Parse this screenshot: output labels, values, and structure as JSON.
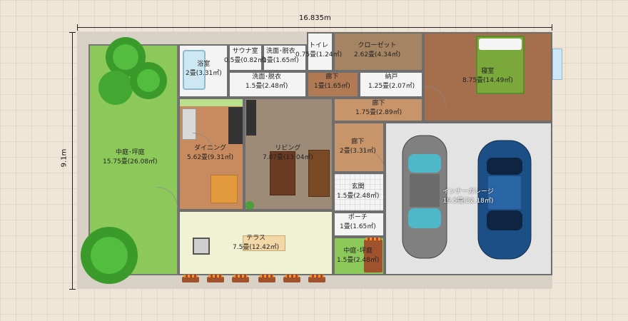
{
  "dimensions": {
    "width_label": "16.835m",
    "height_label": "9.1m"
  },
  "rooms": {
    "garden_left": {
      "name": "中庭･坪庭",
      "area": "15.75畳(26.08㎡)"
    },
    "bath": {
      "name": "浴室",
      "area": "2畳(3.31㎡)"
    },
    "sauna": {
      "name": "サウナ室",
      "area": "0.5畳(0.82㎡)"
    },
    "wash_top": {
      "name": "洗面･脱衣",
      "area": "1畳(1.65㎡)"
    },
    "toilet": {
      "name": "トイレ",
      "area": "0.75畳(1.24㎡)"
    },
    "closet": {
      "name": "クローゼット",
      "area": "2.62畳(4.34㎡)"
    },
    "bedroom": {
      "name": "寝室",
      "area": "8.75畳(14.49㎡)"
    },
    "wash": {
      "name": "洗面･脱衣",
      "area": "1.5畳(2.48㎡)"
    },
    "hall_small": {
      "name": "廊下",
      "area": "1畳(1.65㎡)"
    },
    "storage": {
      "name": "納戸",
      "area": "1.25畳(2.07㎡)"
    },
    "hall_mid": {
      "name": "廊下",
      "area": "1.75畳(2.89㎡)"
    },
    "dining": {
      "name": "ダイニング",
      "area": "5.62畳(9.31㎡)"
    },
    "living": {
      "name": "リビング",
      "area": "7.87畳(13.04㎡)"
    },
    "hall_lower": {
      "name": "廊下",
      "area": "2畳(3.31㎡)"
    },
    "entrance": {
      "name": "玄関",
      "area": "1.5畳(2.48㎡)"
    },
    "porch": {
      "name": "ポーチ",
      "area": "1畳(1.65㎡)"
    },
    "garage": {
      "name": "インナーガレージ",
      "area": "19.5畳(32.18㎡)"
    },
    "terrace": {
      "name": "テラス",
      "area": "7.5畳(12.42㎡)"
    },
    "garden_small": {
      "name": "中庭･坪庭",
      "area": "1.5畳(2.48㎡)"
    }
  },
  "colors": {
    "garden": "#8cc85a",
    "wood_floor": "#b07a55",
    "living_floor": "#9d8b77",
    "tile": "#f4f4f4",
    "terrace": "#f1f2d4",
    "garage": "#e3e3e3",
    "wall": "#6e6e6e",
    "car_gray": "#808080",
    "car_blue": "#1c4f86"
  },
  "icons": [
    "tree-icon",
    "car-icon",
    "bed-icon",
    "table-icon",
    "sofa-icon",
    "kitchen-icon",
    "planter-icon",
    "bbq-grill-icon",
    "door-swing-icon"
  ]
}
